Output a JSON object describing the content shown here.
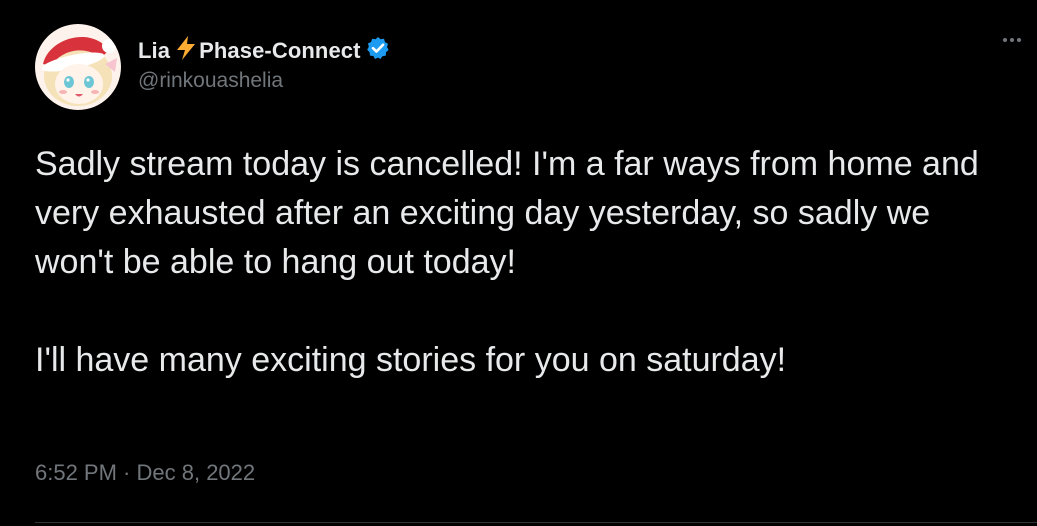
{
  "author": {
    "name_first": "Lia",
    "name_second": "Phase-Connect",
    "bolt_icon": "lightning-bolt-emoji",
    "verified_icon": "verified-badge-icon",
    "handle": "@rinkouashelia"
  },
  "tweet": {
    "paragraph_1": "Sadly stream today is cancelled! I'm a far ways from home and very exhausted after an exciting day yesterday, so sadly we won't be able to hang out today!",
    "paragraph_2": "I'll have many exciting stories for you on saturday!"
  },
  "meta": {
    "time": "6:52 PM",
    "separator": " · ",
    "date": "Dec 8, 2022"
  },
  "colors": {
    "background": "#000000",
    "primary_text": "#e7e9ea",
    "secondary_text": "#71767b",
    "verified_blue": "#1d9bf0",
    "bolt_yellow": "#ffac33"
  }
}
